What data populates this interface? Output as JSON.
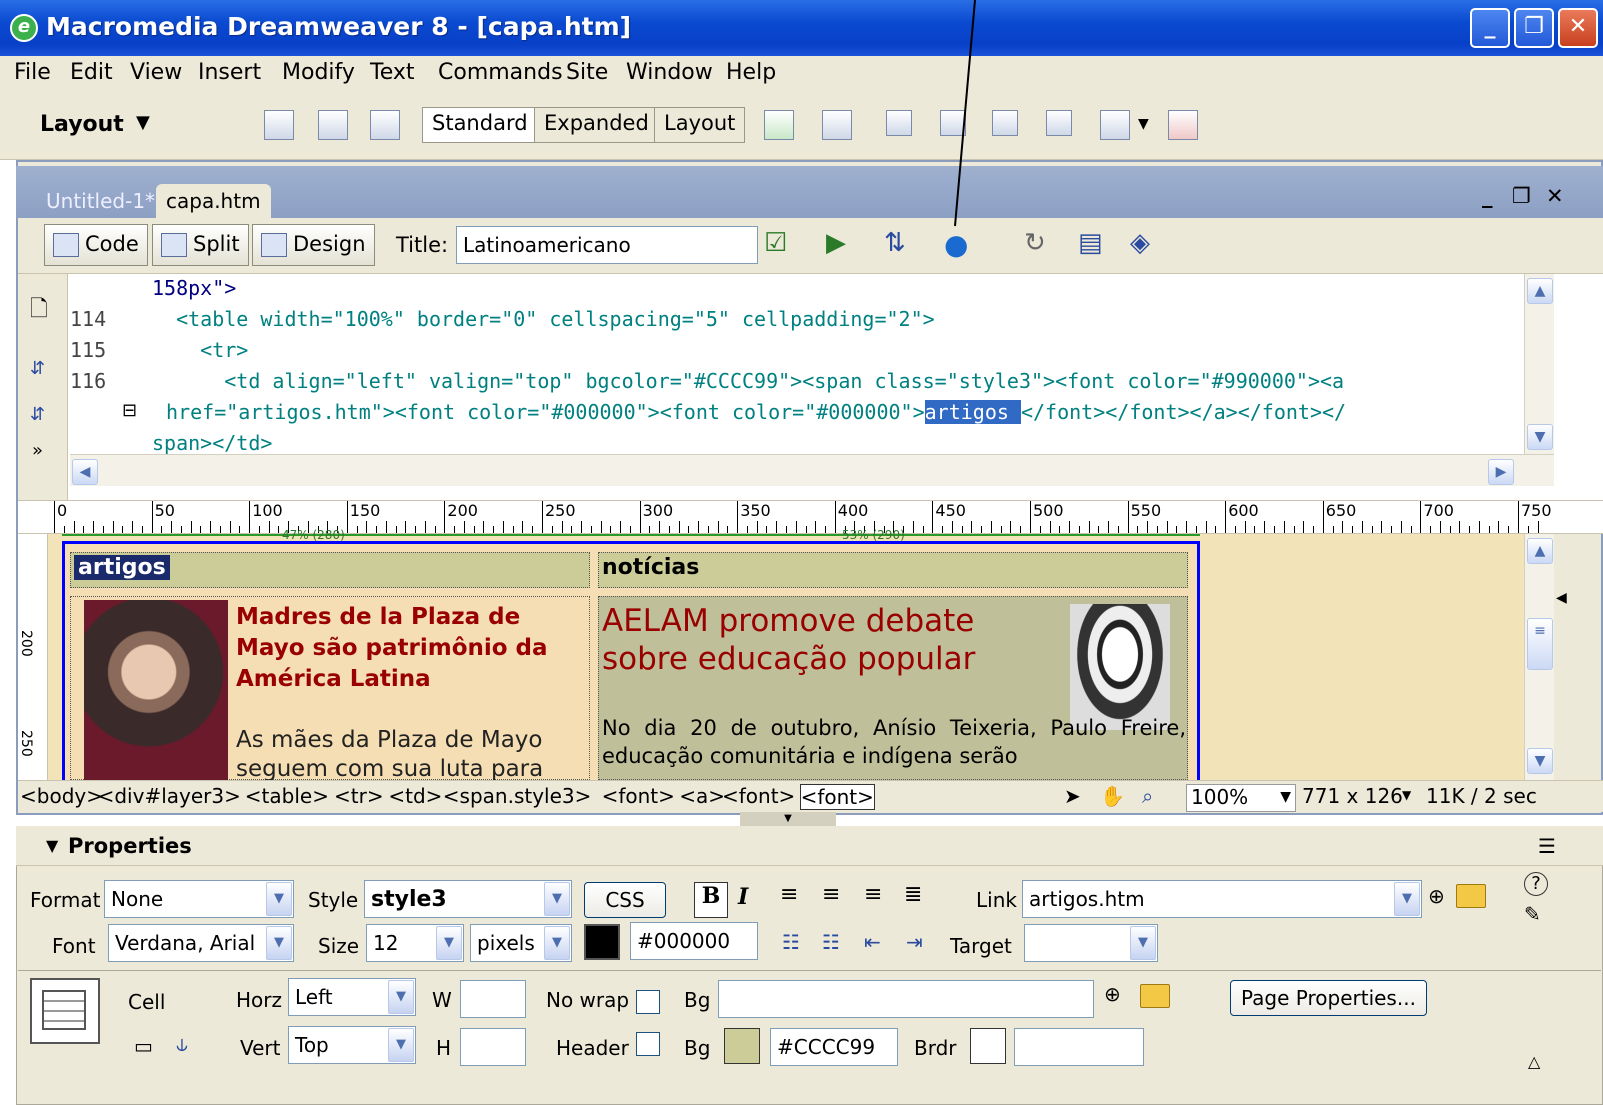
{
  "window": {
    "title": "Macromedia Dreamweaver 8 - [capa.htm]"
  },
  "menu": [
    "File",
    "Edit",
    "View",
    "Insert",
    "Modify",
    "Text",
    "Commands",
    "Site",
    "Window",
    "Help"
  ],
  "insert_bar": {
    "category": "Layout",
    "modes": [
      "Standard",
      "Expanded",
      "Layout"
    ],
    "active_mode": "Standard"
  },
  "doc_tabs": [
    {
      "label": "Untitled-1*",
      "active": false
    },
    {
      "label": "capa.htm",
      "active": true
    }
  ],
  "doc_toolbar": {
    "views": [
      "Code",
      "Split",
      "Design"
    ],
    "title_label": "Title:",
    "title_value": "Latinoamericano"
  },
  "code": {
    "lines": [
      {
        "num": "",
        "text": "158px\">"
      },
      {
        "num": "114",
        "text": "  <table width=\"100%\" border=\"0\" cellspacing=\"5\" cellpadding=\"2\">"
      },
      {
        "num": "115",
        "text": "    <tr>"
      },
      {
        "num": "116",
        "text": "      <td align=\"left\" valign=\"top\" bgcolor=\"#CCCC99\"><span class=\"style3\"><font color=\"#990000\"><a"
      },
      {
        "num": "",
        "pre": " href=\"artigos.htm\"><font color=\"#000000\"><font color=\"#000000\">",
        "selected": "artigos ",
        "post": "</font></font></a></font></"
      },
      {
        "num": "",
        "text": "span></td>"
      }
    ]
  },
  "ruler": {
    "labels": [
      "0",
      "50",
      "100",
      "150",
      "200",
      "250",
      "300",
      "350",
      "400",
      "450",
      "500",
      "550",
      "600",
      "650",
      "700",
      "750"
    ],
    "marker_left": "47% (280)",
    "marker_right": "53% (290)"
  },
  "vruler": {
    "labels": [
      "200",
      "250"
    ]
  },
  "design": {
    "col1_header": "artigos",
    "col2_header": "notícias",
    "article1_title": "Madres de la Plaza de Mayo são patrimônio da América Latina",
    "article1_body": "As mães da Plaza de Mayo seguem com sua luta para",
    "article2_title": "AELAM promove debate sobre educação popular",
    "article2_body": "No dia 20 de outubro, Anísio Teixeria, Paulo Freire, educação comunitária e indígena serão"
  },
  "tag_selector": {
    "tags": [
      "<body>",
      "<div#layer3>",
      "<table>",
      "<tr>",
      "<td>",
      "<span.style3>",
      "<font>",
      "<a>",
      "<font>",
      "<font>"
    ],
    "zoom": "100%",
    "size": "771 x 126",
    "filesize": "11K / 2 sec"
  },
  "properties": {
    "title": "Properties",
    "format_label": "Format",
    "format_value": "None",
    "style_label": "Style",
    "style_value": "style3",
    "css_button": "CSS",
    "bold": "B",
    "italic": "I",
    "link_label": "Link",
    "link_value": "artigos.htm",
    "font_label": "Font",
    "font_value": "Verdana, Arial",
    "size_label": "Size",
    "size_value": "12",
    "size_unit": "pixels",
    "color_value": "#000000",
    "target_label": "Target",
    "target_value": "",
    "cell_label": "Cell",
    "horz_label": "Horz",
    "horz_value": "Left",
    "vert_label": "Vert",
    "vert_value": "Top",
    "w_label": "W",
    "w_value": "",
    "h_label": "H",
    "h_value": "",
    "nowrap_label": "No wrap",
    "header_label": "Header",
    "bg_label": "Bg",
    "bg_value": "",
    "bg2_label": "Bg",
    "bg2_value": "#CCCC99",
    "brdr_label": "Brdr",
    "brdr_value": "",
    "page_props_button": "Page Properties..."
  },
  "colors": {
    "titlebar": "#0a4ad0",
    "chrome": "#ece9d8",
    "cell_bg": "#CCCC99",
    "dark_red": "#990000",
    "table_border": "#0000ff"
  }
}
